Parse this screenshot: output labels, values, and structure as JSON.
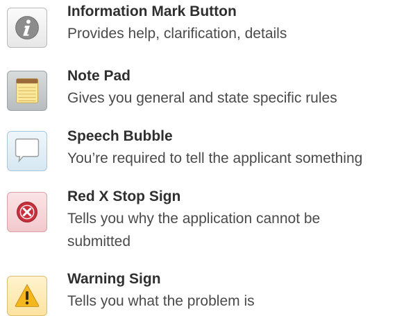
{
  "items": [
    {
      "icon": "information-icon",
      "title": "Information Mark Button",
      "description": "Provides help, clarification, details"
    },
    {
      "icon": "notepad-icon",
      "title": "Note Pad",
      "description": "Gives you general and state specific rules"
    },
    {
      "icon": "speech-bubble-icon",
      "title": "Speech Bubble",
      "description": "You’re required to tell the applicant something"
    },
    {
      "icon": "red-x-stop-icon",
      "title": "Red X Stop Sign",
      "description_line1": "Tells you why the application cannot be",
      "description_line2": "submitted"
    },
    {
      "icon": "warning-icon",
      "title": "Warning Sign",
      "description": "Tells you what the problem is"
    }
  ]
}
